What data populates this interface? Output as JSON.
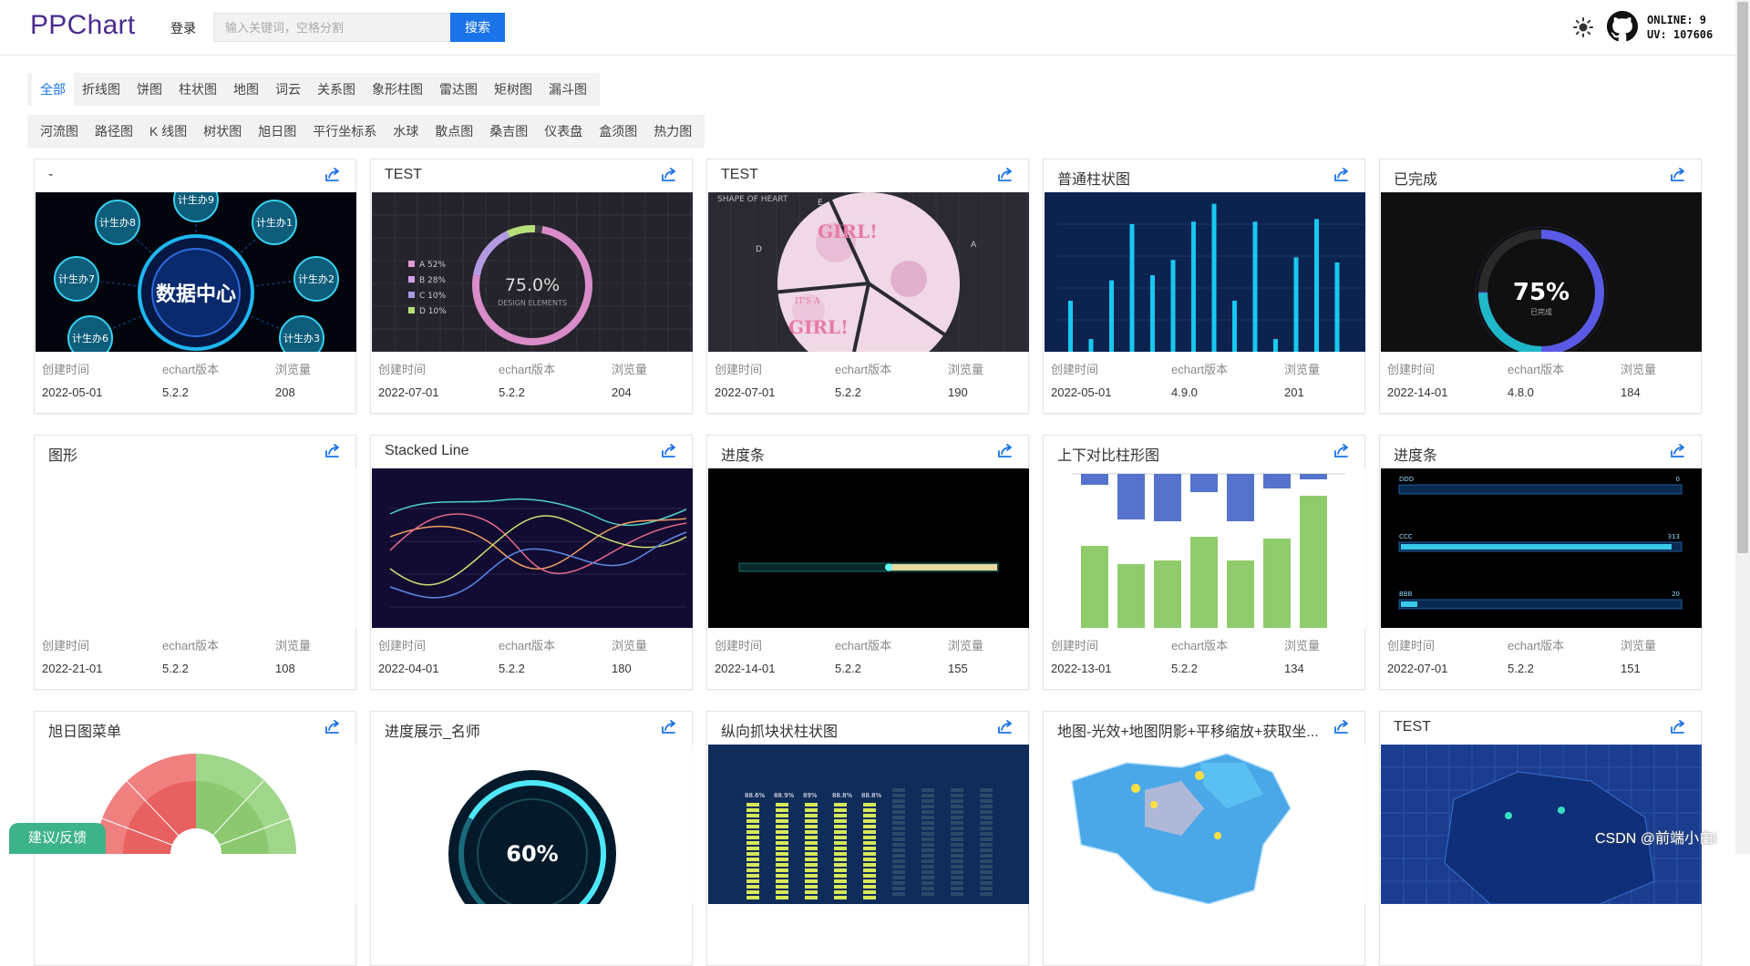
{
  "header": {
    "logo": "PPChart",
    "login": "登录",
    "search_placeholder": "输入关键词，空格分割",
    "search_button": "搜索",
    "online": "ONLINE: 9",
    "uv": "UV: 107606"
  },
  "filters": {
    "row1": [
      "全部",
      "折线图",
      "饼图",
      "柱状图",
      "地图",
      "词云",
      "关系图",
      "象形柱图",
      "雷达图",
      "矩树图",
      "漏斗图"
    ],
    "row2": [
      "河流图",
      "路径图",
      "K 线图",
      "树状图",
      "旭日图",
      "平行坐标系",
      "水球",
      "散点图",
      "桑吉图",
      "仪表盘",
      "盒须图",
      "热力图"
    ]
  },
  "meta_labels": {
    "created": "创建时间",
    "version": "echart版本",
    "views": "浏览量"
  },
  "cards": [
    {
      "title": "-",
      "created": "2022-05-01",
      "version": "5.2.2",
      "views": "208"
    },
    {
      "title": "TEST",
      "created": "2022-07-01",
      "version": "5.2.2",
      "views": "204"
    },
    {
      "title": "TEST",
      "created": "2022-07-01",
      "version": "5.2.2",
      "views": "190"
    },
    {
      "title": "普通柱状图",
      "created": "2022-05-01",
      "version": "4.9.0",
      "views": "201"
    },
    {
      "title": "已完成",
      "created": "2022-14-01",
      "version": "4.8.0",
      "views": "184"
    },
    {
      "title": "图形",
      "created": "2022-21-01",
      "version": "5.2.2",
      "views": "108"
    },
    {
      "title": "Stacked Line",
      "created": "2022-04-01",
      "version": "5.2.2",
      "views": "180"
    },
    {
      "title": "进度条",
      "created": "2022-14-01",
      "version": "5.2.2",
      "views": "155"
    },
    {
      "title": "上下对比柱形图",
      "created": "2022-13-01",
      "version": "5.2.2",
      "views": "134"
    },
    {
      "title": "进度条",
      "created": "2022-07-01",
      "version": "5.2.2",
      "views": "151"
    },
    {
      "title": "旭日图菜单"
    },
    {
      "title": "进度展示_名师"
    },
    {
      "title": "纵向抓块状柱状图"
    },
    {
      "title": "地图-光效+地图阴影+平移缩放+获取坐..."
    },
    {
      "title": "TEST"
    }
  ],
  "thumbs": {
    "t1_center": "数据中心",
    "t1_nodes": [
      "计生办9",
      "计生办8",
      "计生办1",
      "计生办7",
      "计生办2",
      "计生办6",
      "计生办3"
    ],
    "t2_percent": "75.0%",
    "t2_sub": "DESIGN ELEMENTS",
    "t2_legend": [
      "A 52%",
      "B 28%",
      "C 10%",
      "D 10%"
    ],
    "t3_heading": "SHAPE OF HEART",
    "t3_labels": [
      "E",
      "D",
      "A"
    ],
    "t3_texts": [
      "GIRL!",
      "IT'S A",
      "GIRL!"
    ],
    "t5_percent": "75%",
    "t5_sub": "已完成",
    "t12_percent": "60%",
    "t13_values": [
      "88.6%",
      "88.9%",
      "89%",
      "88.8%",
      "88.8%"
    ],
    "t10_labels": [
      {
        "name": "DDD",
        "value": "0",
        "fill": 0
      },
      {
        "name": "CCC",
        "value": "313",
        "fill": 0.97
      },
      {
        "name": "BBB",
        "value": "20",
        "fill": 0.06
      }
    ]
  },
  "feedback": "建议/反馈",
  "watermark": "CSDN @前端小白i"
}
